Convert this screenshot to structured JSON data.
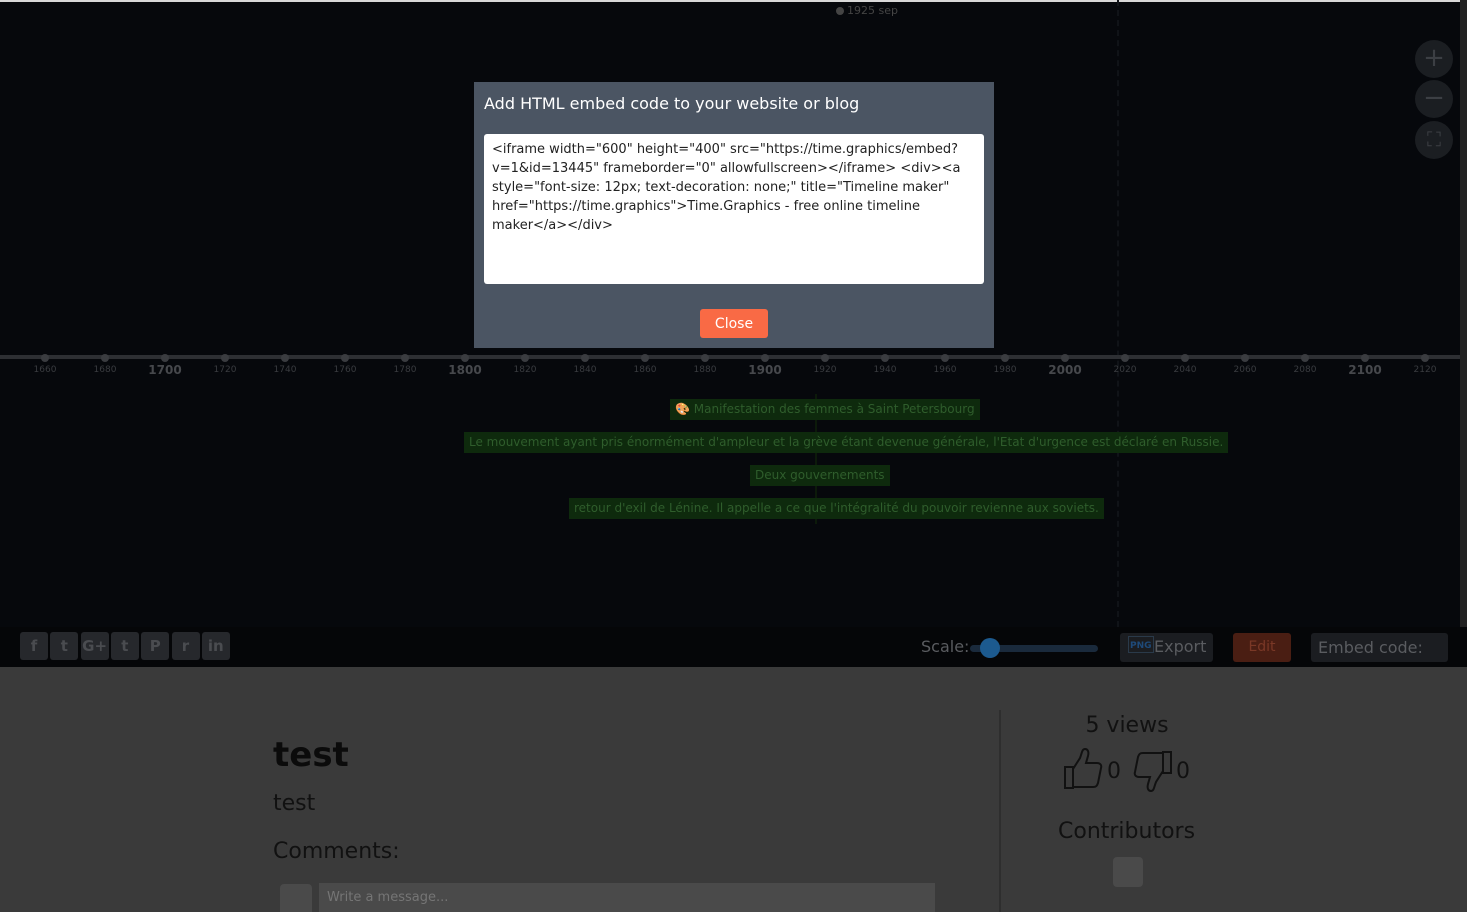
{
  "timeline": {
    "top_event": "1925 sep",
    "zoom_in": "+",
    "zoom_out": "−",
    "fullscreen": "⛶",
    "axis_ticks": [
      {
        "year": "1660",
        "major": false
      },
      {
        "year": "1680",
        "major": false
      },
      {
        "year": "1700",
        "major": true
      },
      {
        "year": "1720",
        "major": false
      },
      {
        "year": "1740",
        "major": false
      },
      {
        "year": "1760",
        "major": false
      },
      {
        "year": "1780",
        "major": false
      },
      {
        "year": "1800",
        "major": true
      },
      {
        "year": "1820",
        "major": false
      },
      {
        "year": "1840",
        "major": false
      },
      {
        "year": "1860",
        "major": false
      },
      {
        "year": "1880",
        "major": false
      },
      {
        "year": "1900",
        "major": true
      },
      {
        "year": "1920",
        "major": false
      },
      {
        "year": "1940",
        "major": false
      },
      {
        "year": "1960",
        "major": false
      },
      {
        "year": "1980",
        "major": false
      },
      {
        "year": "2000",
        "major": true
      },
      {
        "year": "2020",
        "major": false
      },
      {
        "year": "2040",
        "major": false
      },
      {
        "year": "2060",
        "major": false
      },
      {
        "year": "2080",
        "major": false
      },
      {
        "year": "2100",
        "major": true
      },
      {
        "year": "2120",
        "major": false
      }
    ],
    "events": [
      "🎨 Manifestation des femmes à Saint Petersbourg",
      "Le mouvement ayant pris énormément d'ampleur et la grève étant devenue générale, l'Etat d'urgence est déclaré en Russie.",
      "Deux gouvernements",
      "retour d'exil de Lénine. Il appelle a ce que l'intégralité du pouvoir revienne aux soviets."
    ]
  },
  "modal": {
    "title": "Add HTML embed code to your website or blog",
    "code": "<iframe width=\"600\" height=\"400\" src=\"https://time.graphics/embed?v=1&id=13445\" frameborder=\"0\" allowfullscreen></iframe> <div><a style=\"font-size: 12px; text-decoration: none;\" title=\"Timeline maker\" href=\"https://time.graphics\">Time.Graphics - free online timeline maker</a></div>",
    "close_label": "Close"
  },
  "toolbar": {
    "social": [
      {
        "name": "facebook",
        "glyph": "f"
      },
      {
        "name": "twitter",
        "glyph": "t"
      },
      {
        "name": "google-plus",
        "glyph": "G+"
      },
      {
        "name": "tumblr",
        "glyph": "t"
      },
      {
        "name": "pinterest",
        "glyph": "P"
      },
      {
        "name": "reddit",
        "glyph": "r"
      },
      {
        "name": "linkedin",
        "glyph": "in"
      }
    ],
    "scale_label": "Scale:",
    "scale_level": 0.12,
    "export_icon_text": "PNG",
    "export_label": "Export",
    "edit_label": "Edit",
    "embed_label": "Embed code: </>"
  },
  "content": {
    "title": "test",
    "description": "test",
    "comments_label": "Comments:",
    "message_placeholder": "Write a message...",
    "views": "5 views",
    "likes": "0",
    "dislikes": "0",
    "contributors_label": "Contributors"
  }
}
